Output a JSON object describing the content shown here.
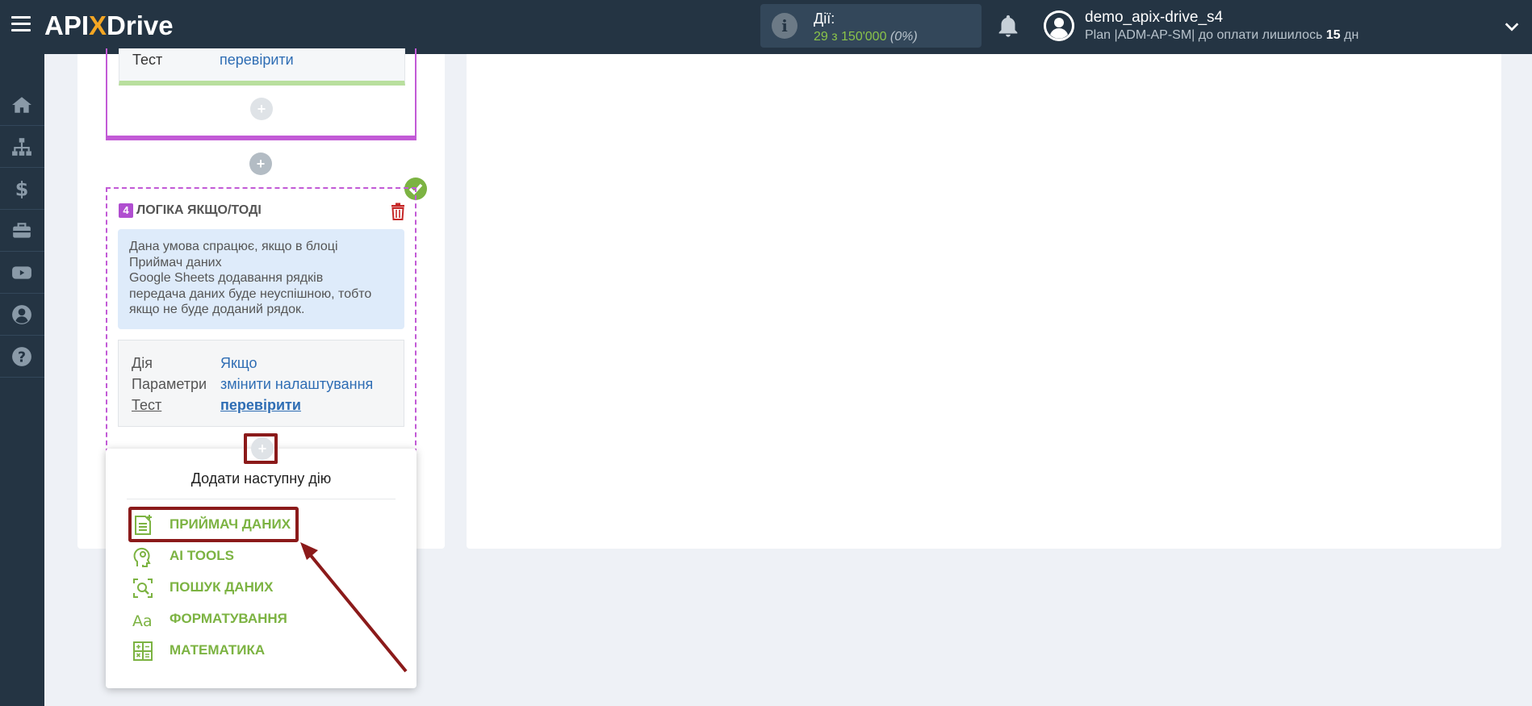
{
  "app": {
    "logo_api": "API",
    "logo_x": "X",
    "logo_drive": "Drive"
  },
  "header": {
    "stats_label": "Дії:",
    "stats_value": "29 з 150'000",
    "stats_percent": "(0%)",
    "username": "demo_apix-drive_s4",
    "plan_text": "Plan |ADM-AP-SM| до оплати лишилось",
    "plan_days": "15",
    "plan_unit": "дн"
  },
  "sidebar": {
    "items": [
      {
        "icon": "home-icon"
      },
      {
        "icon": "sitemap-icon"
      },
      {
        "icon": "dollar-icon"
      },
      {
        "icon": "briefcase-icon"
      },
      {
        "icon": "youtube-icon"
      },
      {
        "icon": "user-icon"
      },
      {
        "icon": "help-icon"
      }
    ]
  },
  "block3": {
    "test_label": "Тест",
    "test_value": "перевірити"
  },
  "block4": {
    "number": "4",
    "title": "ЛОГІКА ЯКЩО/ТОДІ",
    "description_lines": [
      "Дана умова спрацює, якщо в блоці",
      "Приймач даних",
      "Google Sheets додавання рядків",
      "передача даних буде неуспішною, тобто",
      "якщо не буде доданий рядок."
    ],
    "rows": [
      {
        "label": "Дія",
        "value": "Якщо"
      },
      {
        "label": "Параметри",
        "value": "змінити налаштування"
      },
      {
        "label": "Тест",
        "value": "перевірити"
      }
    ]
  },
  "dropdown": {
    "title": "Додати наступну дію",
    "items": [
      {
        "label": "ПРИЙМАЧ ДАНИХ",
        "icon": "receiver-icon"
      },
      {
        "label": "AI TOOLS",
        "icon": "ai-head-icon"
      },
      {
        "label": "ПОШУК ДАНИХ",
        "icon": "search-data-icon"
      },
      {
        "label": "ФОРМАТУВАННЯ",
        "icon": "format-icon"
      },
      {
        "label": "МАТЕМАТИКА",
        "icon": "calculator-icon"
      }
    ]
  },
  "colors": {
    "topbar": "#243443",
    "accent_purple": "#c25ad6",
    "accent_green": "#7cb342",
    "link_blue": "#2e6db4",
    "highlight_red": "#8b1a1a"
  }
}
